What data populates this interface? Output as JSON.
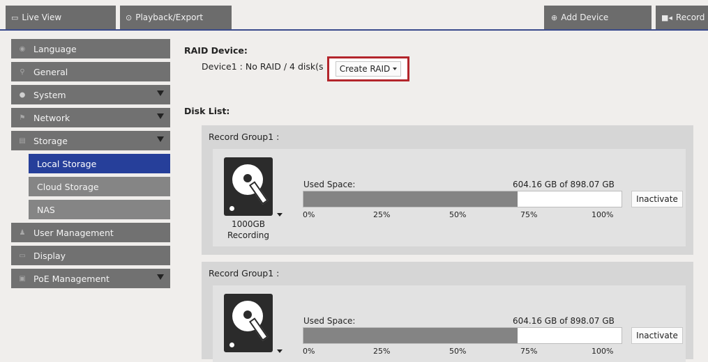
{
  "topbar": {
    "live_view": "Live View",
    "playback": "Playback/Export",
    "add_device": "Add Device",
    "record": "Record"
  },
  "sidebar": {
    "items": [
      {
        "label": "Language"
      },
      {
        "label": "General"
      },
      {
        "label": "System"
      },
      {
        "label": "Network"
      },
      {
        "label": "Storage"
      },
      {
        "label": "Local Storage"
      },
      {
        "label": "Cloud Storage"
      },
      {
        "label": "NAS"
      },
      {
        "label": "User Management"
      },
      {
        "label": "Display"
      },
      {
        "label": "PoE Management"
      }
    ]
  },
  "raid": {
    "heading": "RAID Device:",
    "device_text": "Device1 :  No RAID / 4 disk(s",
    "create_label": "Create RAID"
  },
  "disk_list": {
    "heading": "Disk List:",
    "groups": [
      {
        "title": "Record Group1 :",
        "disk_size": "1000GB",
        "disk_state": "Recording",
        "used_label": "Used Space:",
        "used_value": "604.16 GB of 898.07 GB",
        "used_fraction": 0.673,
        "ticks": [
          "0%",
          "25%",
          "50%",
          "75%",
          "100%"
        ],
        "button": "Inactivate"
      },
      {
        "title": "Record Group1 :",
        "used_label": "Used Space:",
        "used_value": "604.16 GB of 898.07 GB",
        "used_fraction": 0.673,
        "ticks": [
          "0%",
          "25%",
          "50%",
          "75%",
          "100%"
        ],
        "button": "Inactivate"
      }
    ]
  },
  "colors": {
    "accent": "#263f9a",
    "highlight_border": "#b3252b",
    "sidebar_bg": "#717171"
  }
}
